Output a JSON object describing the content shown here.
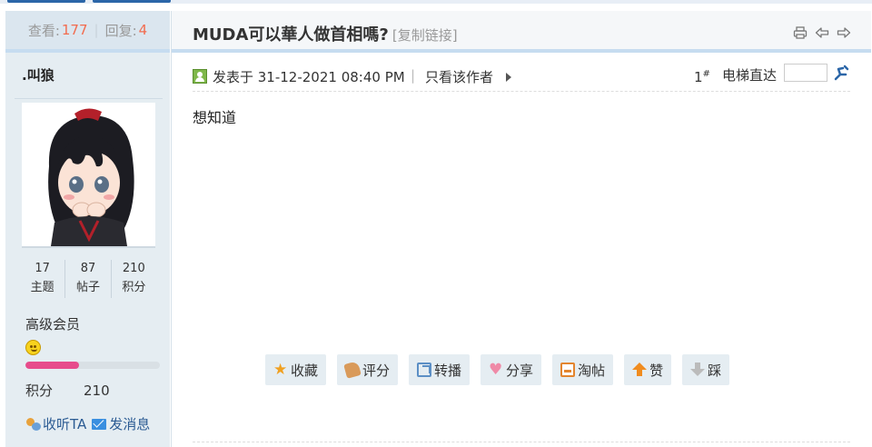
{
  "stats_header": {
    "views_label": "查看:",
    "views": "177",
    "separator": "|",
    "replies_label": "回复:",
    "replies": "4"
  },
  "author": {
    "name": ".叫狼",
    "threads": "17",
    "threads_label": "主题",
    "posts": "87",
    "posts_label": "帖子",
    "credits": "210",
    "credits_label": "积分",
    "rank": "高级会员",
    "rank_progress": 0.4,
    "credit_label": "积分",
    "credit_value": "210",
    "follow_label": "收听TA",
    "message_label": "发消息"
  },
  "thread": {
    "title": "MUDA可以華人做首相嗎?",
    "copy_link": "[复制链接]"
  },
  "post": {
    "posted_at": "发表于 31-12-2021 08:40 PM",
    "meta_separator": "|",
    "only_author": "只看该作者",
    "floor": "1",
    "floor_mark": "#",
    "jump_label": "电梯直达",
    "jump_value": "",
    "content": "想知道"
  },
  "buttons": {
    "favorite": "收藏",
    "rate": "评分",
    "repost": "转播",
    "share": "分享",
    "taotie": "淘帖",
    "like": "赞",
    "dislike": "踩"
  },
  "icons": {
    "print": "print-icon",
    "prev": "prev-thread-icon",
    "next": "next-thread-icon",
    "go": "go-floor-icon"
  },
  "colors": {
    "accent_blue": "#2b66a8",
    "count_red": "#f26c4f",
    "sidebar_bg": "#e5edf2",
    "progress_pink": "#e74c8c"
  }
}
